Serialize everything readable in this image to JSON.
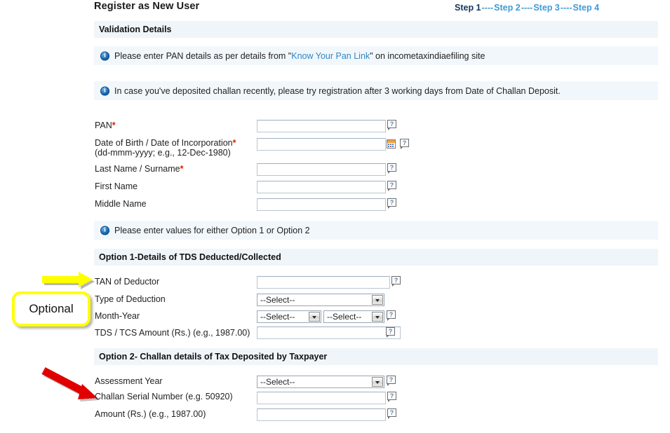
{
  "header": {
    "title": "Register as New User",
    "steps": [
      {
        "label": "Step 1",
        "current": true
      },
      {
        "label": "Step 2",
        "current": false
      },
      {
        "label": "Step 3",
        "current": false
      },
      {
        "label": "Step 4",
        "current": false
      }
    ],
    "step_separator": "----"
  },
  "sections": {
    "validation": {
      "title": "Validation Details"
    },
    "option1": {
      "title": "Option 1-Details of TDS Deducted/Collected"
    },
    "option2": {
      "title": "Option 2- Challan details of Tax Deposited by Taxpayer"
    }
  },
  "notices": {
    "pan": {
      "pre": "Please enter PAN details as per details from \"",
      "link": "Know Your Pan Link",
      "post": "\" on incometaxindiaefiling site"
    },
    "challan": {
      "text": "In case you've deposited challan recently, please try registration after 3 working days from Date of Challan Deposit."
    },
    "options": {
      "text": "Please enter values for either Option 1 or Option 2"
    }
  },
  "fields": {
    "pan": {
      "label": "PAN",
      "required": true,
      "value": "",
      "placeholder": ""
    },
    "dob": {
      "label": "Date of Birth / Date of Incorporation",
      "hint": "(dd-mmm-yyyy; e.g., 12-Dec-1980)",
      "required": true,
      "value": "",
      "placeholder": ""
    },
    "last_name": {
      "label": "Last Name / Surname",
      "required": true,
      "value": "",
      "placeholder": ""
    },
    "first_name": {
      "label": "First Name",
      "required": false,
      "value": "",
      "placeholder": ""
    },
    "middle_name": {
      "label": "Middle Name",
      "required": false,
      "value": "",
      "placeholder": ""
    },
    "tan": {
      "label": "TAN of Deductor",
      "required": false,
      "value": "",
      "placeholder": ""
    },
    "type_of_deduction": {
      "label": "Type of Deduction",
      "selected": "--Select--"
    },
    "month_year": {
      "label": "Month-Year",
      "month_selected": "--Select--",
      "year_selected": "--Select--"
    },
    "tds_amount": {
      "label": "TDS / TCS Amount (Rs.) (e.g., 1987.00)",
      "value": "",
      "placeholder": ""
    },
    "assessment_year": {
      "label": "Assessment Year",
      "selected": "--Select--"
    },
    "challan_serial": {
      "label": "Challan Serial Number (e.g. 50920)",
      "value": "",
      "placeholder": ""
    },
    "amount": {
      "label": "Amount (Rs.) (e.g., 1987.00)",
      "value": "",
      "placeholder": ""
    }
  },
  "annotations": {
    "optional_callout": {
      "text": "Optional",
      "color": "#ffff00"
    },
    "yellow_arrow": {
      "color": "#ffff00",
      "points_to": "TAN of Deductor"
    },
    "red_arrow": {
      "color": "#e00000",
      "points_to": "Challan Serial Number"
    }
  },
  "colors": {
    "bar_bg": "#f0f5fa",
    "info_bg": "#f2f7fb",
    "link": "#2f86c4",
    "required": "#e01b00",
    "step_current": "#14365c",
    "step_next": "#3d9bd6"
  }
}
